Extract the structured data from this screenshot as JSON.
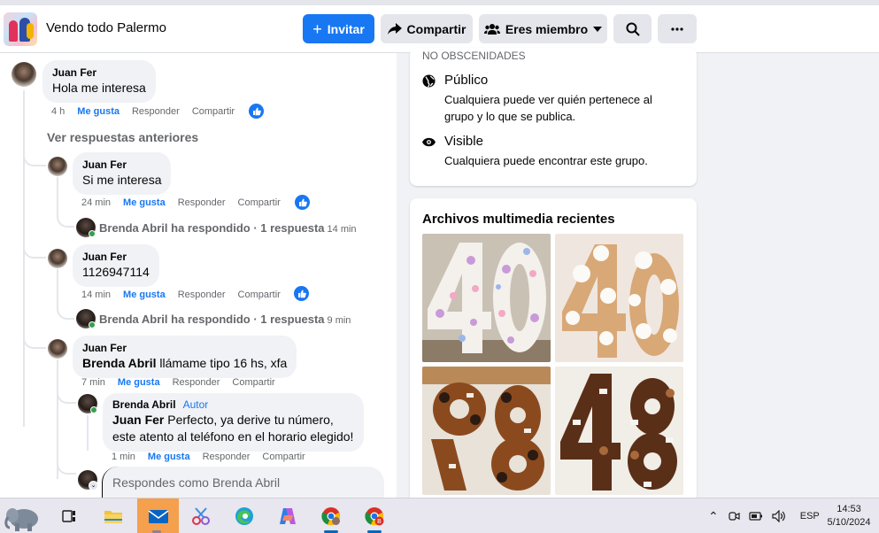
{
  "header": {
    "group_name": "Vendo todo Palermo",
    "invite_label": "Invitar",
    "share_label": "Compartir",
    "member_label": "Eres miembro"
  },
  "comments": {
    "c1": {
      "author": "Juan Fer",
      "text": "Hola me interesa",
      "time": "4 h",
      "like": "Me gusta",
      "reply": "Responder",
      "share": "Compartir"
    },
    "see_previous": "Ver respuestas anteriores",
    "c2": {
      "author": "Juan Fer",
      "text": "Si me interesa",
      "time": "24 min",
      "like": "Me gusta",
      "reply": "Responder",
      "share": "Compartir"
    },
    "r2": {
      "who": "Brenda Abril ha respondido",
      "sep": " · ",
      "count": "1 respuesta",
      "time": "14 min"
    },
    "c3": {
      "author": "Juan Fer",
      "text": "1126947114",
      "time": "14 min",
      "like": "Me gusta",
      "reply": "Responder",
      "share": "Compartir"
    },
    "r3": {
      "who": "Brenda Abril ha respondido",
      "sep": " · ",
      "count": "1 respuesta",
      "time": "9 min"
    },
    "c4": {
      "author": "Juan Fer",
      "mention": "Brenda Abril",
      "text": " llámame tipo 16 hs, xfa",
      "time": "7 min",
      "like": "Me gusta",
      "reply": "Responder",
      "share": "Compartir"
    },
    "c5": {
      "author": "Brenda Abril",
      "badge": "Autor",
      "mention": "Juan Fer",
      "text": " Perfecto, ya derive tu número, este atento al teléfono en el horario elegido!",
      "time": "1 min",
      "like": "Me gusta",
      "reply": "Responder",
      "share": "Compartir"
    },
    "input_placeholder": "Respondes como Brenda Abril"
  },
  "about": {
    "partial_text": "NO OBSCENIDADES",
    "public_title": "Público",
    "public_desc": "Cualquiera puede ver quién pertenece al grupo y lo que se publica.",
    "visible_title": "Visible",
    "visible_desc": "Cualquiera puede encontrar este grupo."
  },
  "media": {
    "title": "Archivos multimedia recientes"
  },
  "taskbar": {
    "lang": "ESP",
    "time": "14:53",
    "date": "5/10/2024"
  },
  "colors": {
    "accent": "#1877f2",
    "active_taskbar": "#f4a04c"
  }
}
